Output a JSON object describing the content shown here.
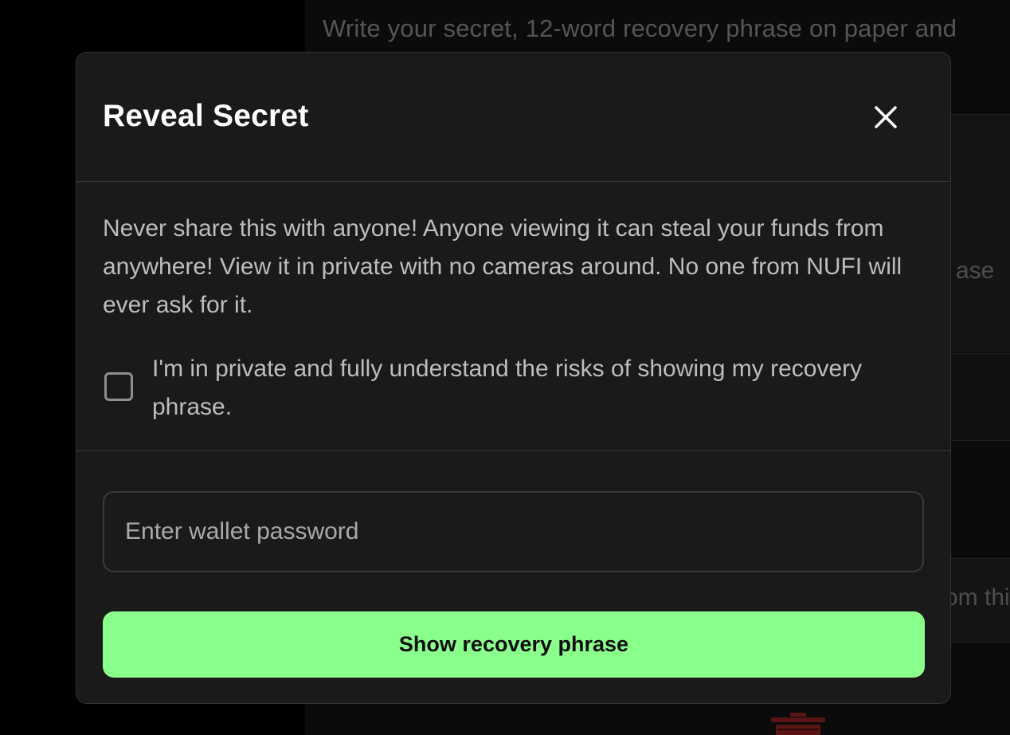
{
  "background": {
    "intro_text": "Write your secret, 12-word recovery phrase on paper and",
    "fragment_1": "ase",
    "fragment_2": "om thi",
    "trash_icon": "trash-icon",
    "danger_color": "#5a1414"
  },
  "modal": {
    "title": "Reveal Secret",
    "close_icon": "close-icon",
    "warning_text": "Never share this with anyone! Anyone viewing it can steal your funds from anywhere! View it in private with no cameras around. No one from NUFI will ever ask for it.",
    "consent": {
      "label": "I'm in private and fully understand the risks of showing my recovery phrase.",
      "checked": false
    },
    "password": {
      "placeholder": "Enter wallet password",
      "value": ""
    },
    "submit_label": "Show recovery phrase",
    "accent_color": "#8bff8c"
  }
}
